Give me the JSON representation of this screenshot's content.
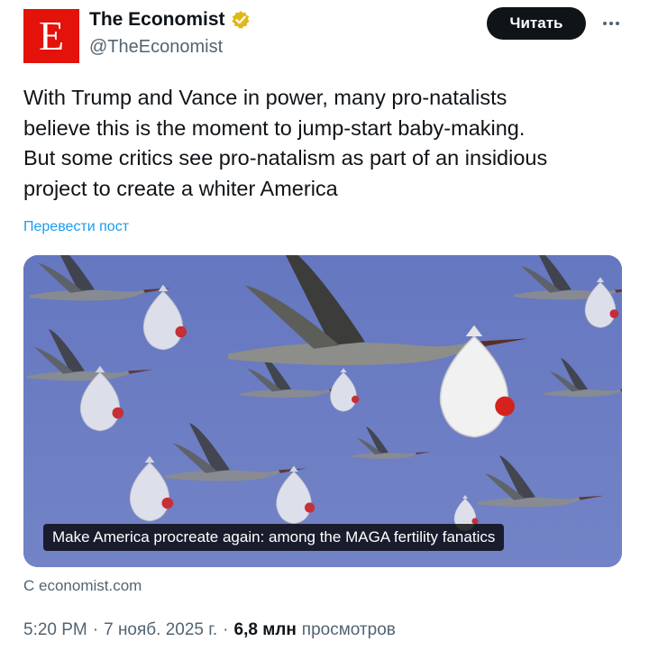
{
  "author": {
    "avatar_letter": "E",
    "name": "The Economist",
    "handle": "@TheEconomist",
    "brand_color": "#e3120b",
    "verified_icon": "verified-gold-badge-icon"
  },
  "header": {
    "follow_label": "Читать",
    "more_icon": "more-dots-icon"
  },
  "tweet": {
    "text": "With Trump and Vance in power, many pro-natalists\nbelieve this is the moment to jump-start baby-making.\nBut some critics see pro-natalism as part of an insidious\nproject to create a whiter America",
    "translate_label": "Перевести пост"
  },
  "card": {
    "headline": "Make America procreate again: among the MAGA fertility fanatics",
    "source": "С economist.com"
  },
  "meta": {
    "time": "5:20 PM",
    "separator": "·",
    "date": "7 нояб. 2025 г.",
    "views_count": "6,8 млн",
    "views_label": "просмотров"
  },
  "colors": {
    "accent_blue": "#1d9bf0",
    "sky": "#6d7bc2",
    "text_primary": "#0f1419",
    "text_secondary": "#536471"
  }
}
